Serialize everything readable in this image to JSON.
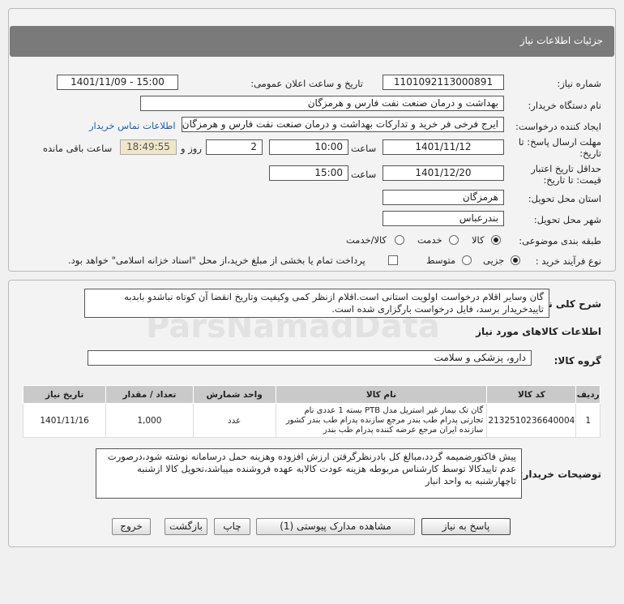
{
  "title": "جزئیات اطلاعات نیاز",
  "fields": {
    "need_number_label": "شماره نیاز:",
    "need_number": "1101092113000891",
    "announce_label": "تاریخ و ساعت اعلان عمومی:",
    "announce_value": "1401/11/09 - 15:00",
    "buyer_org_label": "نام دستگاه خریدار:",
    "buyer_org": "بهداشت و درمان صنعت نفت فارس و هرمزگان",
    "creator_label": "ایجاد کننده درخواست:",
    "creator": "ایرج  فرخی فر خرید و تدارکات بهداشت و درمان صنعت نفت فارس و هرمزگان",
    "contact_link": "اطلاعات تماس خریدار",
    "deadline_label_1": "مهلت ارسال پاسخ: تا",
    "deadline_label_2": "تاریخ:",
    "deadline_date": "1401/11/12",
    "time_label": "ساعت",
    "deadline_time": "10:00",
    "days": "2",
    "days_label": "روز و",
    "remaining": "18:49:55",
    "remaining_label": "ساعت باقی مانده",
    "validity_label_1": "حداقل تاریخ اعتبار",
    "validity_label_2": "قیمت: تا تاریخ:",
    "validity_date": "1401/12/20",
    "validity_time": "15:00",
    "province_label": "استان محل تحویل:",
    "province": "هرمزگان",
    "city_label": "شهر محل تحویل:",
    "city": "بندرعباس",
    "category_label": "طبقه بندی موضوعی:",
    "cat_goods": "کالا",
    "cat_service": "خدمت",
    "cat_goods_service": "کالا/خدمت",
    "process_label": "نوع فرآیند خرید :",
    "proc_partial": "جزیی",
    "proc_medium": "متوسط",
    "payment_note": "پرداخت تمام یا بخشی از مبلغ خرید،از محل \"اسناد خزانه اسلامی\" خواهد بود."
  },
  "bottom": {
    "general_desc_label": "شرح کلی نیاز:",
    "general_desc": "گان وسایر اقلام درخواست اولویت استانی است.اقلام ازنظر کمی وکیفیت وتاریخ انقضا آن کوتاه نباشدو بابدبه تاییدخریدار برسد، فایل درخواست بارگزاری شده است.",
    "goods_info_title": "اطلاعات کالاهای مورد نیاز",
    "goods_group_label": "گروه کالا:",
    "goods_group": "دارو، پزشکی و سلامت",
    "table_headers": [
      "ردیف",
      "کد کالا",
      "نام کالا",
      "واحد شمارش",
      "تعداد / مقدار",
      "تاریخ نیاز"
    ],
    "rows": [
      {
        "row": "1",
        "code": "2132510236640004",
        "name": "گان تک بیمار غیر استریل مدل PTB بسته 1 عددی نام تجارتی پدرام طب بندر مرجع سازنده پدرام طب بندر کشور سازنده ایران مرجع عرضه کننده پدرام طب بندر",
        "unit": "عدد",
        "qty": "1,000",
        "date": "1401/11/16"
      }
    ],
    "buyer_notes_label": "توضیحات خریدار:",
    "buyer_notes": "پیش فاکتورضمیمه گردد،مبالغ کل بادرنظرگرفتن ارزش افزوده وهزینه حمل درسامانه نوشته شود،درصورت عدم تاییدکالا توسط کارشناس مربوطه هزینه عودت کالابه عهده فروشنده میباشد،تحویل کالا ازشنبه تاچهارشنبه به واحد انبار"
  },
  "buttons": {
    "reply": "پاسخ به نیاز",
    "attachments": "مشاهده مدارک پیوستی (1)",
    "print": "چاپ",
    "back": "بازگشت",
    "exit": "خروج"
  }
}
